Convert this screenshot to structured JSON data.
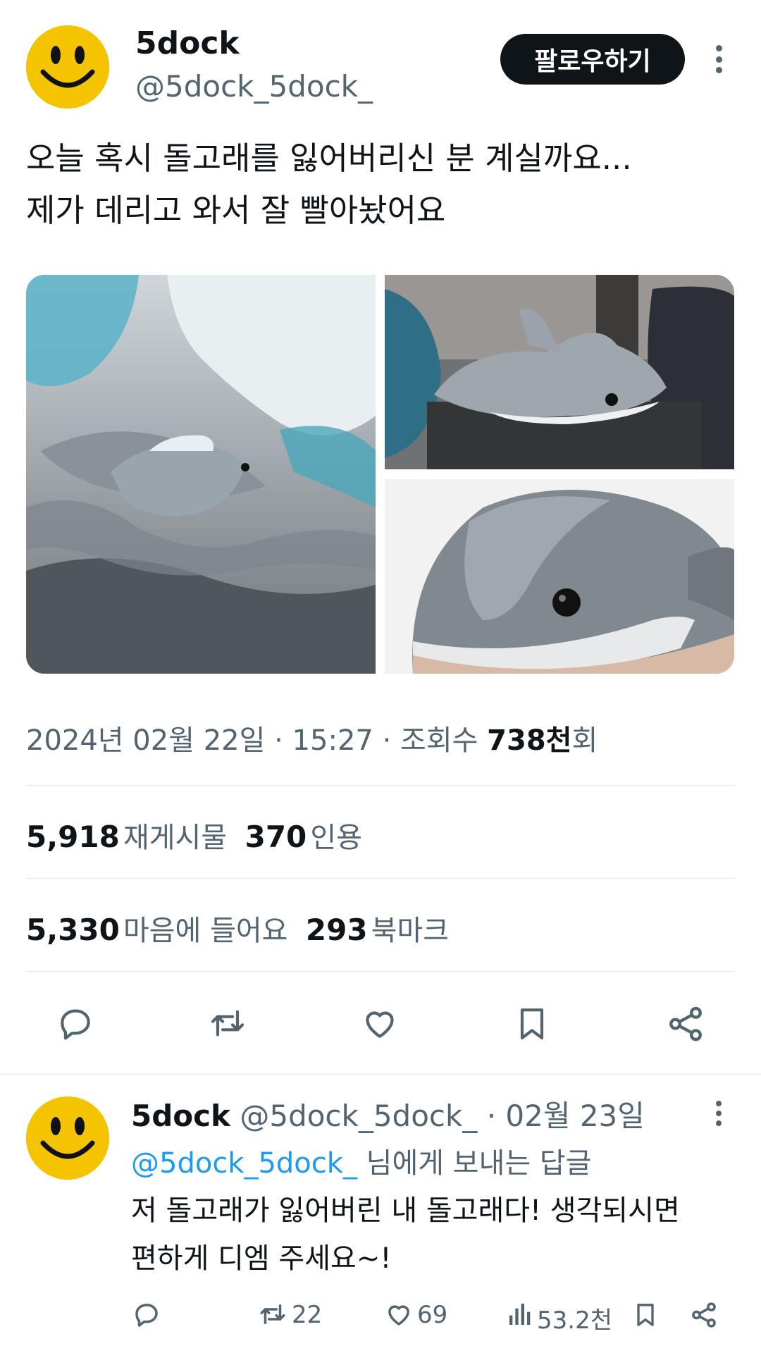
{
  "tweet": {
    "author_name": "5dock",
    "author_handle": "@5dock_5dock_",
    "follow_label": "팔로우하기",
    "text": "오늘 혹시 돌고래를 잃어버리신 분 계실까요...\n제가 데리고 와서 잘 빨아놨어요",
    "date": "2024년 02월 22일",
    "time": "15:27",
    "views_label": "조회수",
    "views_value": "738천",
    "views_suffix": "회",
    "retweets": "5,918",
    "retweets_label": "재게시물",
    "quotes": "370",
    "quotes_label": "인용",
    "likes": "5,330",
    "likes_label": "마음에 들어요",
    "bookmarks": "293",
    "bookmarks_label": "북마크"
  },
  "reply": {
    "author_name": "5dock",
    "author_handle": "@5dock_5dock_",
    "date": "02월 23일",
    "replying_to": "@5dock_5dock_",
    "replying_suffix": "님에게 보내는 답글",
    "text": "저 돌고래가 잃어버린 내 돌고래다! 생각되시면\n편하게 디엠 주세요~!",
    "retweet_count": "22",
    "like_count": "69",
    "view_count": "53.2천"
  },
  "colors": {
    "accent": "#1d9bf0",
    "text_primary": "#0f1419",
    "text_secondary": "#536471",
    "avatar_yellow": "#f5c400"
  },
  "icons": [
    "reply-icon",
    "retweet-icon",
    "like-icon",
    "bookmark-icon",
    "share-icon",
    "more-icon",
    "views-icon"
  ]
}
